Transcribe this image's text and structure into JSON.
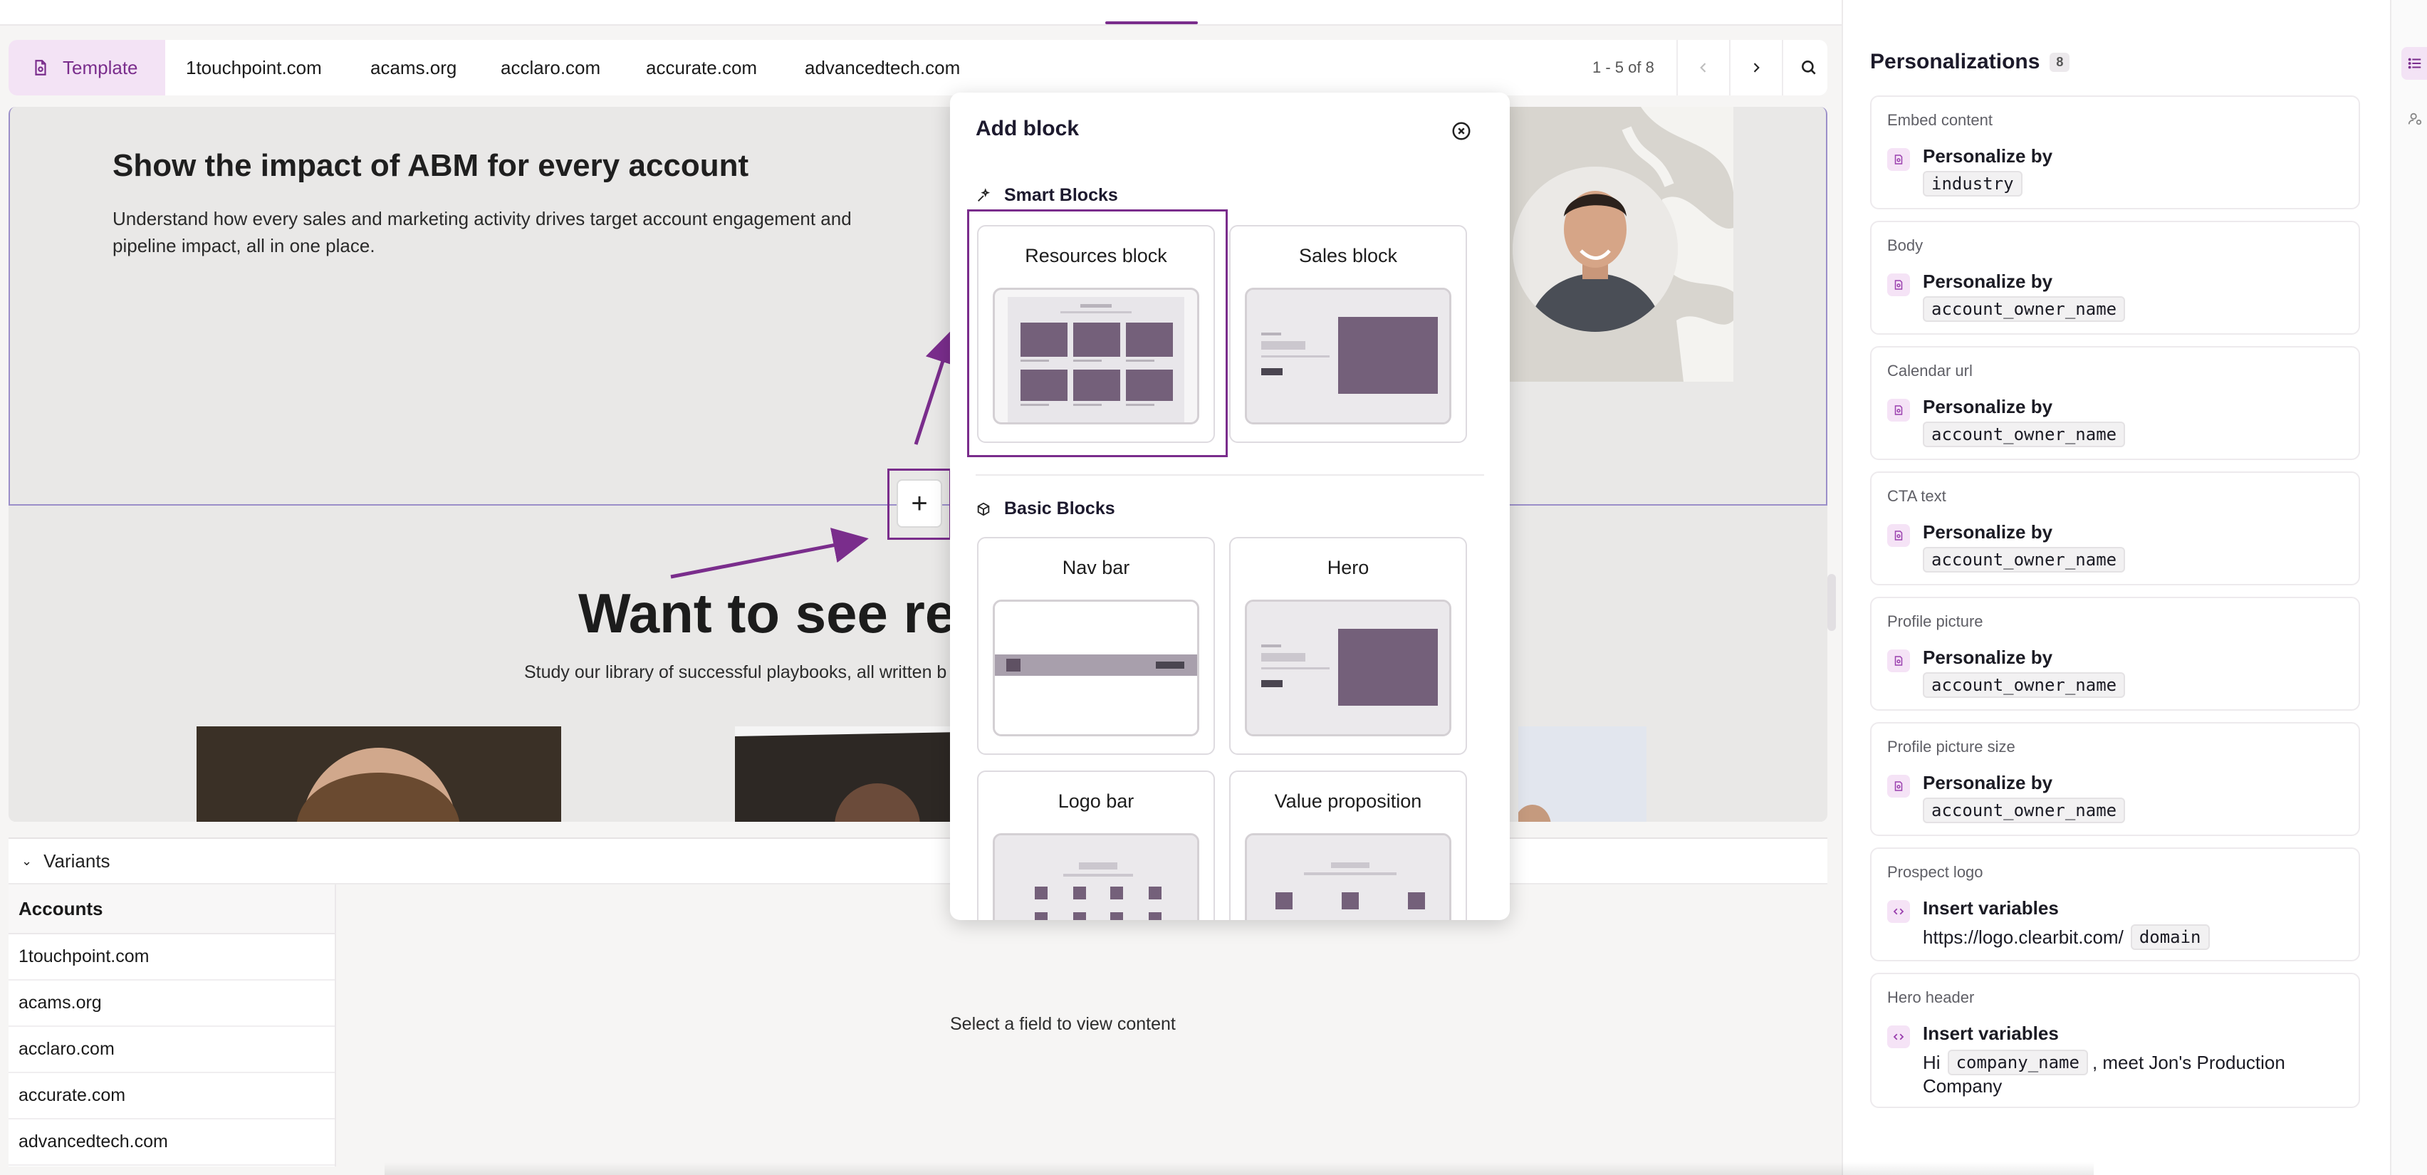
{
  "account_tabs": {
    "template_label": "Template",
    "accounts": [
      "1touchpoint.com",
      "acams.org",
      "acclaro.com",
      "accurate.com",
      "advancedtech.com"
    ],
    "pager_text": "1 - 5 of 8"
  },
  "canvas": {
    "hero_title": "Show the impact of ABM for every account",
    "hero_description": "Understand how every sales and marketing activity drives target account engagement and pipeline impact, all in one place.",
    "section_title": "Want to see rea",
    "section_description": "Study our library of successful playbooks, all written b",
    "add_button_symbol": "+"
  },
  "add_block_modal": {
    "title": "Add block",
    "smart_blocks_label": "Smart Blocks",
    "basic_blocks_label": "Basic Blocks",
    "smart_blocks": [
      "Resources block",
      "Sales block"
    ],
    "basic_blocks": [
      "Nav bar",
      "Hero",
      "Logo bar",
      "Value proposition"
    ]
  },
  "variants": {
    "header": "Variants",
    "accounts_header": "Accounts",
    "accounts": [
      "1touchpoint.com",
      "acams.org",
      "acclaro.com",
      "accurate.com",
      "advancedtech.com"
    ],
    "empty_hint": "Select a field to view content"
  },
  "personalizations": {
    "title": "Personalizations",
    "count": "8",
    "items": [
      {
        "field": "Embed content",
        "action": "Personalize by",
        "value": "industry"
      },
      {
        "field": "Body",
        "action": "Personalize by",
        "value": "account_owner_name"
      },
      {
        "field": "Calendar url",
        "action": "Personalize by",
        "value": "account_owner_name"
      },
      {
        "field": "CTA text",
        "action": "Personalize by",
        "value": "account_owner_name"
      },
      {
        "field": "Profile picture",
        "action": "Personalize by",
        "value": "account_owner_name"
      },
      {
        "field": "Profile picture size",
        "action": "Personalize by",
        "value": "account_owner_name"
      },
      {
        "field": "Prospect logo",
        "action": "Insert variables",
        "prefix": "https://logo.clearbit.com/",
        "value": "domain"
      },
      {
        "field": "Hero header",
        "action": "Insert variables",
        "prefix": "Hi",
        "value": "company_name",
        "suffix": ", meet Jon's Production",
        "suffix2": "Company"
      }
    ]
  },
  "colors": {
    "accent": "#7a2d8c",
    "accent_light": "#f3e3f5",
    "block_fill": "#74607a"
  }
}
